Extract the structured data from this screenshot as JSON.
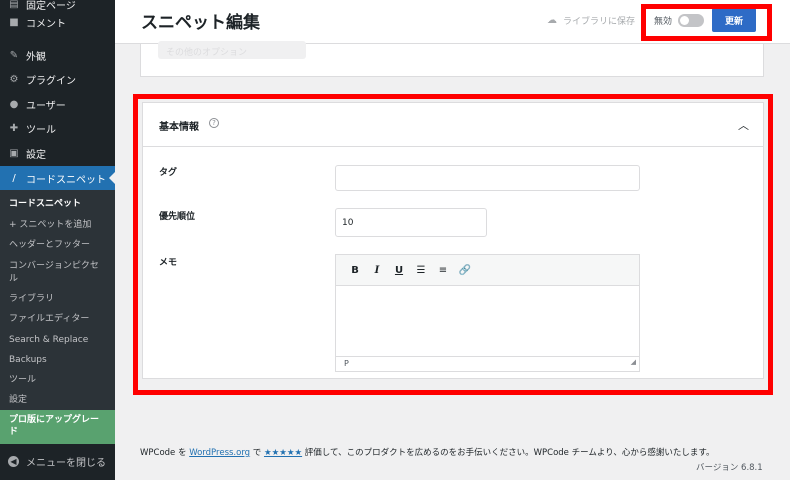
{
  "sidebar": {
    "items": [
      {
        "label": "固定ページ",
        "icon": "page-icon"
      },
      {
        "label": "コメント",
        "icon": "comment-icon"
      },
      {
        "label": "外観",
        "icon": "appearance-icon"
      },
      {
        "label": "プラグイン",
        "icon": "plugin-icon"
      },
      {
        "label": "ユーザー",
        "icon": "user-icon"
      },
      {
        "label": "ツール",
        "icon": "wrench-icon"
      },
      {
        "label": "設定",
        "icon": "settings-icon"
      },
      {
        "label": "コードスニペット",
        "icon": "code-icon"
      }
    ],
    "submenu": [
      "コードスニペット",
      "+ スニペットを追加",
      "ヘッダーとフッター",
      "コンバージョンピクセ",
      "ル",
      "ライブラリ",
      "ファイルエディター",
      "Search & Replace",
      "Backups",
      "ツール",
      "設定"
    ],
    "upgrade_line1": "プロ版にアップグレー",
    "upgrade_line2": "ド",
    "collapse_label": "メニューを閉じる"
  },
  "header": {
    "title": "スニペット編集",
    "library_status": "ライブラリに保存",
    "toggle_label": "無効",
    "update_label": "更新"
  },
  "top_card": {
    "ghost_label": "その他のオプション"
  },
  "basic_info": {
    "title": "基本情報",
    "tag_label": "タグ",
    "tag_value": "",
    "priority_label": "優先順位",
    "priority_value": "10",
    "memo_label": "メモ",
    "editor_status": "P"
  },
  "footer": {
    "text_prefix": "WPCode を ",
    "wp_link": "WordPress.org",
    "text_mid": " で ",
    "stars": "★★★★★",
    "text_suffix": " 評価して、このプロダクトを広めるのをお手伝いください。WPCode チームより、心から感謝いたします。",
    "version": "バージョン 6.8.1"
  },
  "colors": {
    "sidebar_bg": "#1d2327",
    "active_blue": "#2271b1",
    "update_button": "#2e6bc6",
    "upgrade_green": "#59a26f",
    "highlight_red": "#ff0000"
  }
}
